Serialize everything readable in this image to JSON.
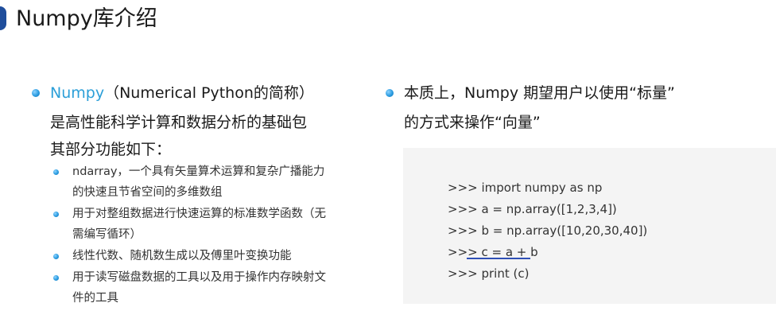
{
  "title": "Numpy库介绍",
  "left": {
    "bullet1": {
      "accent_word": "Numpy",
      "rest": "（Numerical Python的简称）"
    },
    "line2": "是高性能科学计算和数据分析的基础包",
    "line3": "其部分功能如下：",
    "subitems": [
      {
        "line1": "ndarray，一个具有矢量算术运算和复杂广播能力",
        "line2": "的快速且节省空间的多维数组"
      },
      {
        "line1": "用于对整组数据进行快速运算的标准数学函数（无",
        "line2": "需编写循环）"
      },
      {
        "line1": "线性代数、随机数生成以及傅里叶变换功能",
        "line2": ""
      },
      {
        "line1": "用于读写磁盘数据的工具以及用于操作内存映射文",
        "line2": "件的工具"
      }
    ]
  },
  "right": {
    "line1": "本质上，Numpy 期望用户以使用“标量”",
    "line2": "的方式来操作“向量”",
    "code": [
      ">>> import numpy as np",
      ">>> a = np.array([1,2,3,4])",
      ">>> b = np.array([10,20,30,40])",
      ">>> c = a + b",
      ">>> print (c)"
    ]
  },
  "colors": {
    "accent": "#2c9fd8",
    "title_marker": "#1f4e9c",
    "code_background": "#f4f4f4",
    "underline": "#2e4fb5"
  }
}
